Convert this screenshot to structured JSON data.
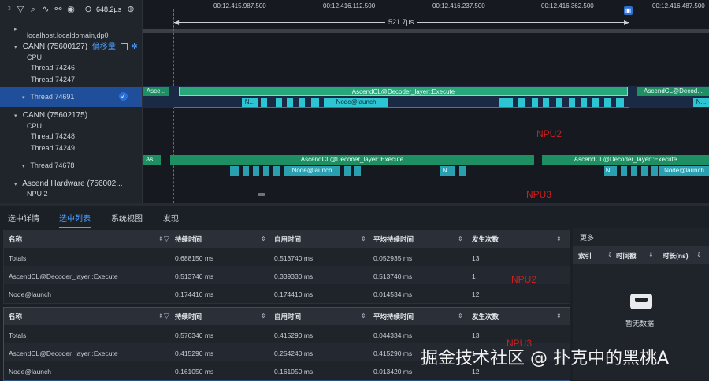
{
  "toolbar": {
    "zoom_value": "648.2µs"
  },
  "tree": {
    "host": "localhost.localdomain,dp0",
    "proc1": "CANN (75600127)",
    "proc1_tag": "偏移量",
    "cpu1": "CPU",
    "t1": "Thread 74246",
    "t2": "Thread 74247",
    "t3": "Thread 74691",
    "proc2": "CANN (75602175)",
    "cpu2": "CPU",
    "t4": "Thread 74248",
    "t5": "Thread 74249",
    "t6": "Thread 74678",
    "hw": "Ascend Hardware (756002...",
    "npu": "NPU 2"
  },
  "timeline": {
    "ticks": [
      "00:12.415.987.500",
      "00:12.416.112.500",
      "00:12.416.237.500",
      "00:12.416.362.500",
      "00:12.416.487.500"
    ],
    "range_label": "521.7µs",
    "exec_label": "AscendCL@Decoder_layer::Execute",
    "exec_short1": "Asce...",
    "exec_short2": "AscendCL@Decod...",
    "exec_short3": "As...",
    "node_label": "Node@launch",
    "node_short": "N...",
    "npu2": "NPU2",
    "npu3": "NPU3"
  },
  "tabs": {
    "t1": "选中详情",
    "t2": "选中列表",
    "t3": "系统视图",
    "t4": "发现"
  },
  "table1": {
    "headers": {
      "name": "名称",
      "dur": "持续时间",
      "self": "自用时间",
      "avg": "平均持续时间",
      "count": "发生次数"
    },
    "rows": [
      {
        "name": "Totals",
        "dur": "0.688150 ms",
        "self": "0.513740 ms",
        "avg": "0.052935 ms",
        "count": "13"
      },
      {
        "name": "AscendCL@Decoder_layer::Execute",
        "dur": "0.513740 ms",
        "self": "0.339330 ms",
        "avg": "0.513740 ms",
        "count": "1"
      },
      {
        "name": "Node@launch",
        "dur": "0.174410 ms",
        "self": "0.174410 ms",
        "avg": "0.014534 ms",
        "count": "12"
      }
    ],
    "note": "NPU2"
  },
  "table2": {
    "headers": {
      "name": "名称",
      "dur": "持续时间",
      "self": "自用时间",
      "avg": "平均持续时间",
      "count": "发生次数"
    },
    "rows": [
      {
        "name": "Totals",
        "dur": "0.576340 ms",
        "self": "0.415290 ms",
        "avg": "0.044334 ms",
        "count": "13"
      },
      {
        "name": "AscendCL@Decoder_layer::Execute",
        "dur": "0.415290 ms",
        "self": "0.254240 ms",
        "avg": "0.415290 ms",
        "count": "1"
      },
      {
        "name": "Node@launch",
        "dur": "0.161050 ms",
        "self": "0.161050 ms",
        "avg": "0.013420 ms",
        "count": "12"
      }
    ],
    "note": "NPU3"
  },
  "side": {
    "more": "更多",
    "col1": "索引",
    "col2": "时间戳",
    "col3": "时长(ns)",
    "empty": "暂无数据"
  },
  "watermark": "掘金技术社区 @ 扑克中的黑桃A"
}
